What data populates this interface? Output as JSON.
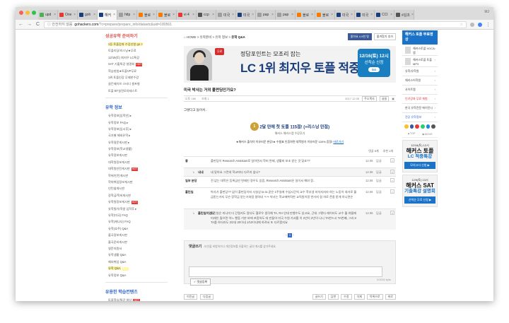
{
  "browser": {
    "tabs": [
      {
        "label": "upd",
        "color": "#4caf50"
      },
      {
        "label": "One",
        "color": "#e53935"
      },
      {
        "label": "goh",
        "color": "#1a3d7c"
      },
      {
        "label": "해커",
        "color": "#1a3d7c"
      },
      {
        "label": "http",
        "color": "#9e9e9e"
      },
      {
        "label": "블로",
        "color": "#f57c00"
      },
      {
        "label": "블로",
        "color": "#f57c00"
      },
      {
        "label": "vi 4",
        "color": "#e53935"
      },
      {
        "label": "ccp",
        "color": "#555555"
      },
      {
        "label": "미국",
        "color": "#9e9e9e"
      },
      {
        "label": "미국",
        "color": "#1a3d7c"
      },
      {
        "label": "pap",
        "color": "#9e9e9e"
      },
      {
        "label": "pap",
        "color": "#9e9e9e"
      },
      {
        "label": "블로",
        "color": "#f57c00"
      },
      {
        "label": "블로",
        "color": "#f57c00"
      },
      {
        "label": "미국",
        "color": "#1a3d7c"
      },
      {
        "label": "미국",
        "color": "#1a3d7c"
      },
      {
        "label": "CCI",
        "color": "#1a3d7c"
      },
      {
        "label": "#김조",
        "color": "#555555"
      }
    ],
    "profile": "MJ",
    "url_security": "ⓘ 안전하지 않음",
    "url_host": "gohackers.com",
    "url_path": "/?c=prepare/prepare_info/dataetc&uid=180561",
    "back": "←",
    "forward": "→",
    "reload": "C",
    "home": "⌂"
  },
  "lnb": {
    "section1_title": "성공유학 준비하기",
    "section1_items": [
      {
        "label": "1등 토플강좌 수강신청 go >",
        "highlight": true,
        "hot": false
      },
      {
        "label": "토플리딩/리스닝★무료",
        "highlight": false,
        "hot": false
      },
      {
        "label": "12/16(토) 최지우 LC특강",
        "highlight": false,
        "hot": false
      },
      {
        "label": "SAT 기출특강 설명회",
        "highlight": false,
        "hot": true
      },
      {
        "label": "학습방법★토플VP무료",
        "highlight": false,
        "hot": false
      },
      {
        "label": "1위 토플인강 무제한수강",
        "highlight": false,
        "hot": false
      },
      {
        "label": "골든제이브 스터디 셀프형",
        "highlight": false,
        "hot": false
      },
      {
        "label": "토플 BT실전모의테스트",
        "highlight": false,
        "hot": false
      }
    ],
    "section2_title": "유학 정보",
    "section2_items": [
      {
        "label": "유학정보(입학안) ▸",
        "hot": false
      },
      {
        "label": "유학정보 FAQ ▸",
        "hot": false
      },
      {
        "label": "유학정보(입시후) ▸",
        "hot": false
      },
      {
        "label": "국가별 해외유학 ▸",
        "hot": false
      },
      {
        "label": "유학질문게시판 ▸",
        "hot": false
      },
      {
        "label": "유학정보(학교생활)",
        "hot": false
      },
      {
        "label": "유학정보게시판",
        "hot": false
      },
      {
        "label": "대학원정보게시판",
        "hot": false
      },
      {
        "label": "대학원인턴게시판",
        "hot": true
      },
      {
        "label": "학위/인턴게시판",
        "hot": false
      },
      {
        "label": "학위취업정보게시판",
        "hot": false
      },
      {
        "label": "인턴쉽게시판",
        "hot": false
      },
      {
        "label": "장학금/학비게시판",
        "hot": false
      },
      {
        "label": "유학원정보게시판",
        "hot": true
      },
      {
        "label": "유학원/유학생 입학후 ▸",
        "hot": false
      },
      {
        "label": "유학(미국) FAQ",
        "hot": false
      },
      {
        "label": "유학(캐나다) FAQ",
        "hot": false
      },
      {
        "label": "유학(호주) Q&A",
        "hot": false
      },
      {
        "label": "출국정보게시판",
        "hot": false
      },
      {
        "label": "출국준비게시판",
        "hot": false
      },
      {
        "label": "영문지원서",
        "hot": false
      },
      {
        "label": "유학생활 Q&A",
        "hot": false
      },
      {
        "label": "해외취업 Q&A",
        "hot": false
      },
      {
        "label": "유학 Q&A",
        "highlight": true,
        "hot": true
      },
      {
        "label": "유학정보 Q&A",
        "hot": false
      }
    ],
    "section3_title": "유용한 학습컨텐츠",
    "section3_items": [
      {
        "label": "토플학습/특강 영상",
        "hot": true
      },
      {
        "label": "토플 학습방법 추천",
        "hot": true
      }
    ]
  },
  "content": {
    "breadcrumb_home": "HOME",
    "breadcrumb_1": "유학준비",
    "breadcrumb_2": "유학 정보",
    "breadcrumb_current": "유학 Q&A",
    "share_fb": "좋아요 4.9천 명",
    "share_bookmark": "즐겨찾기 추가",
    "banner": {
      "ribbon": "무료",
      "sub": "정답포인트는 모조리 잡는",
      "head": "LC 1위 최지우 토플 적중특강",
      "cta_date": "12/16(토) 12시",
      "cta_text": "선착순 신청",
      "cta_go": "GO"
    },
    "post_title": "미국 박사는 거의 풀펀딩인가요?",
    "post_author": "도토 160",
    "post_views": "조회 1",
    "post_date": "2017.12.05",
    "post_btn1": "주소복사",
    "post_btn2": "글꼴",
    "post_body": "그렇다고 들어서..",
    "promo": {
      "badge": "1",
      "line1": "2달 만에 첫 토플 115점! (+리스닝 만점)",
      "line2": "해커스 해커스랩 수강후기",
      "line3": "★해커스 출석이 이유러운 완강!★ 수험표 인증하면 대학원가 이유러운 100% 증정!",
      "line3_link": "바로가기"
    },
    "react_comments": "댓글 5개",
    "react_likes": "추천 1개",
    "comments": [
      {
        "who": "좋",
        "text": "풀펀딩이 Research Assistant로 일하면서 학비 면제, 생활비 보조 받는 것 맞죠??",
        "when": "12.05",
        "reply_label": "답글",
        "is_reply": false
      },
      {
        "who": "내내",
        "text": "네 맞아요 그런데 학교마다 다르지 않나?",
        "when": "12.06",
        "reply_label": "답글",
        "is_reply": true
      },
      {
        "who": "일부 분당",
        "text": "전 없는 대학은 등록금만 면제인 경우도 있음, Research Assistant은 일이서 해야 함..",
        "when": "12.06",
        "reply_label": "답글",
        "is_reply": false
      },
      {
        "who": "풀린일",
        "text": "박사가 풀펀딩?? 없이 풀펀딩이지 사실상 ta ra 같은 1주일에 수십시간씩 교수 학부생 지치지지라 하는 노동이 대가로 월급받는거지 무슨 장학금 받는거처럼 말하네 ㅋㅋ 박사는 학교에취직한 교직원이랑 반거지 걸 하로 존중 받게 아니면은",
        "when": "12.06",
        "reply_label": "답글",
        "is_reply": false
      },
      {
        "who": "풀린일이었니",
        "text": "풀린일은 미니미 더 간절지도 알다도 헬로우 생각해 TA, RA 인데 만행수도 있고요, 근데 그렇다 레이터도 교수 월 여름에 미래인 많으면 어느 행동 기본 바에 포함하도 대 만들어 미국 수원 가서를 이 2년이 2년이 나니 TA반드시 TA번째, 그리고 TA를 하더라도 2/2내 20이내 1/10이내에 하려서 또 다르겠지요",
        "when": "12.06",
        "reply_label": "답글",
        "is_reply": true
      }
    ],
    "pagination_current": "1",
    "pagination_prev": "‹",
    "pagination_next": "›",
    "write_title": "댓글쓰기",
    "write_notice": "- 타인을 비방하거나 개인정보를 유출하는 글의 게시를 삼가주세요.",
    "write_submit": "✓ 댓글등록",
    "write_count": "0/1000 byte",
    "btn_list": "이전글",
    "btn_next": "다음글",
    "btn_write": "글쓰기",
    "btn_reply": "답변",
    "btn_edit": "수정",
    "btn_delete": "삭제",
    "btn_move": "목록으로",
    "btn_top": "위로"
  },
  "rside": {
    "top": "해커스 토플 무료영상",
    "items": [
      {
        "label": "해커스토플 VOCA 앱",
        "icon": true,
        "style": ""
      },
      {
        "label": "해커스토플 토플 MP3",
        "icon": true,
        "style": ""
      },
      {
        "label": "유학/유학원",
        "icon": false,
        "style": ""
      },
      {
        "label": "해커스어학원",
        "icon": false,
        "style": ""
      },
      {
        "label": "사이트맵",
        "icon": false,
        "style": ""
      },
      {
        "label": "인기강좌 무료 체험",
        "icon": false,
        "style": "red"
      },
      {
        "label": "한국 유학전문 에이전시",
        "icon": false,
        "style": ""
      },
      {
        "label": "전공 유학정보",
        "icon": false,
        "style": "blue"
      }
    ],
    "sns_colors": [
      "#fbc02d",
      "#3b5998",
      "#e53935",
      "#2ecc71",
      "#1e88e5",
      "#555555"
    ],
    "tiny_top": "▲TOP",
    "tiny_move": "▶MOVE",
    "ad1": {
      "line1": "12/16(토) 12시",
      "line2": "해커스 토플",
      "line3": "LC 적중특강",
      "btn": "모의고사 신청 ▶"
    },
    "ad2": {
      "line1": "12/9(토) 13시",
      "line2": "해커스 SAT",
      "line3": "기출특강 설명회",
      "btn": "선착순 무료 신청 ▶"
    }
  }
}
